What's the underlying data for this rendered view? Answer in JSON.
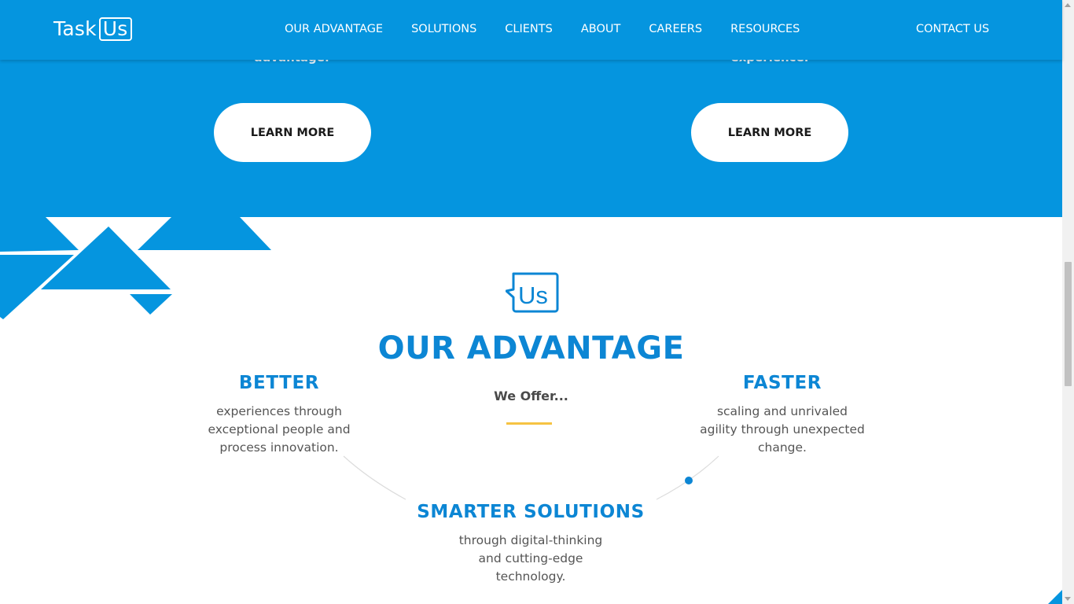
{
  "header": {
    "logo_task": "Task",
    "logo_us": "Us",
    "nav": [
      "OUR ADVANTAGE",
      "SOLUTIONS",
      "CLIENTS",
      "ABOUT",
      "CAREERS",
      "RESOURCES"
    ],
    "contact": "CONTACT US"
  },
  "band": {
    "left_text": "advantage.",
    "right_text": "experience.",
    "left_button": "LEARN MORE",
    "right_button": "LEARN MORE"
  },
  "advantage": {
    "icon_text": "Us",
    "title": "OUR ADVANTAGE",
    "subtitle": "We Offer...",
    "better": {
      "title": "BETTER",
      "desc": [
        "experiences through",
        "exceptional people and",
        "process innovation."
      ]
    },
    "faster": {
      "title": "FASTER",
      "desc": [
        "scaling and unrivaled",
        "agility through unexpected",
        "change."
      ]
    },
    "smarter": {
      "title": "SMARTER SOLUTIONS",
      "desc": [
        "through digital-thinking",
        "and cutting-edge",
        "technology."
      ]
    }
  },
  "colors": {
    "brand_blue": "#0595df",
    "title_blue": "#0c86d4",
    "accent_yellow": "#f6c343"
  }
}
